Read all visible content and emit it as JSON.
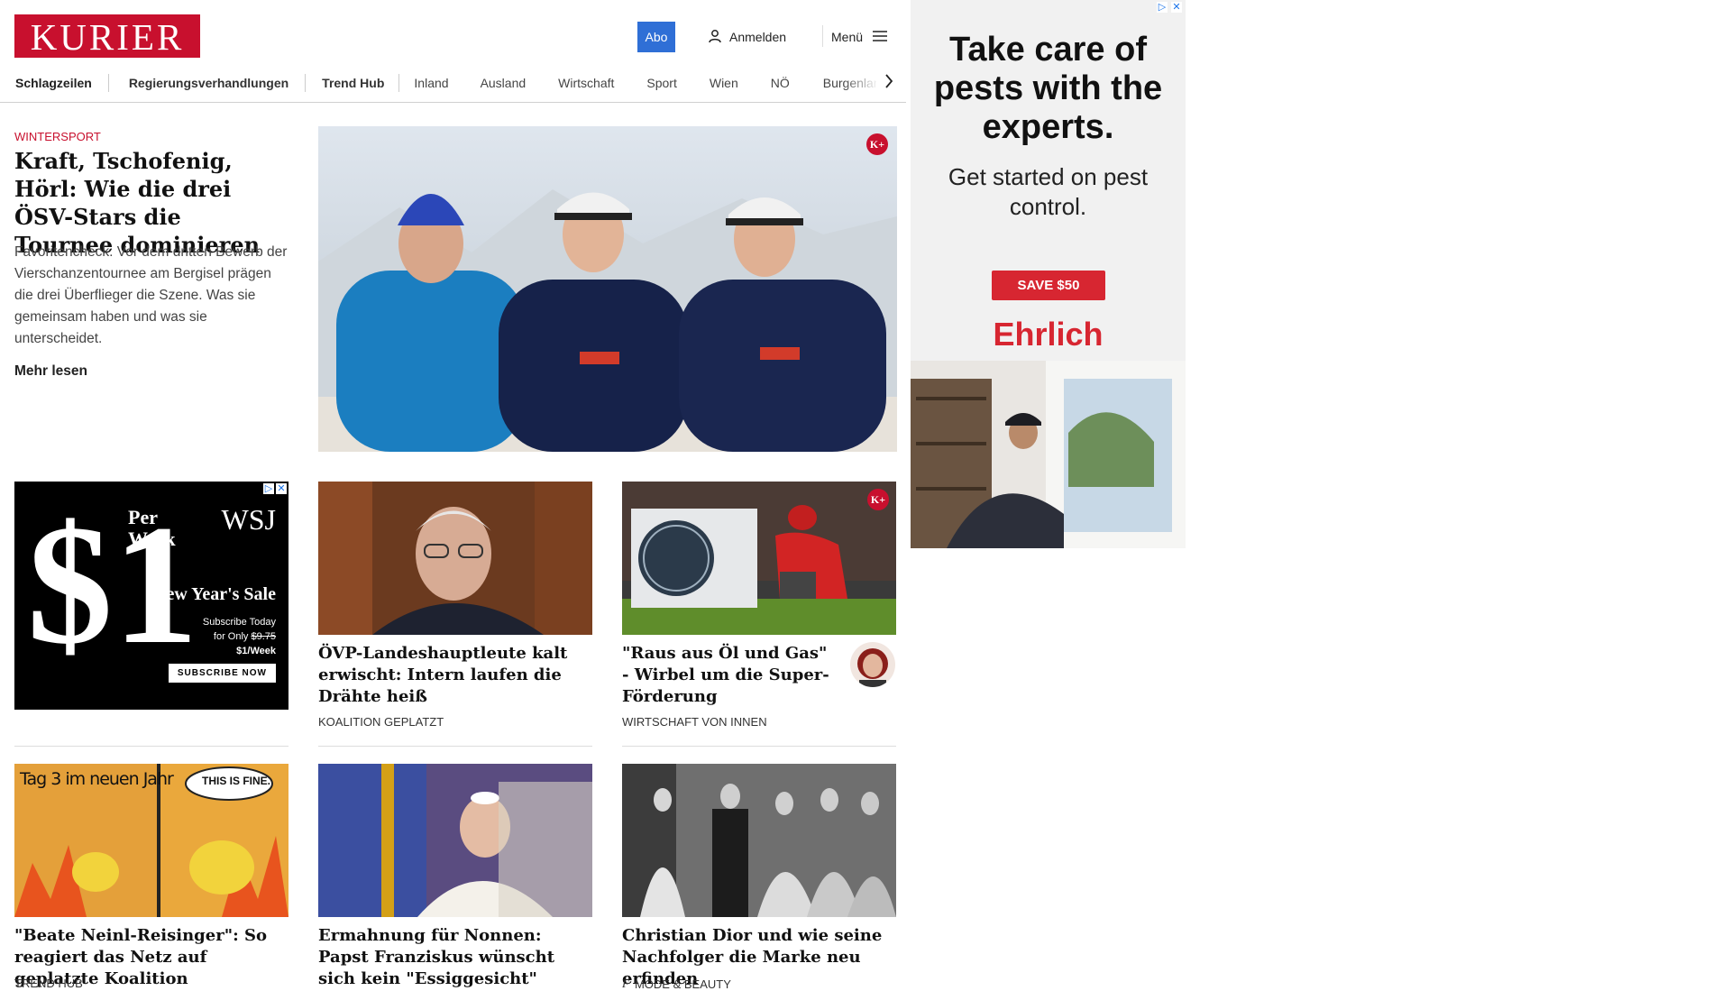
{
  "header": {
    "logo": "KURIER",
    "abo": "Abo",
    "login": "Anmelden",
    "menu": "Menü"
  },
  "nav": {
    "items": [
      "Schlagzeilen",
      "Regierungsverhandlungen",
      "Trend Hub",
      "Inland",
      "Ausland",
      "Wirtschaft",
      "Sport",
      "Wien",
      "NÖ",
      "Burgenland"
    ]
  },
  "lead": {
    "kicker": "WINTERSPORT",
    "title": "Kraft, Tschofenig, Hörl: Wie die drei ÖSV-Stars die Tournee dominieren",
    "teaser": "Favoritencheck: Vor dem dritten Bewerb der Vierschanzentournee am Bergisel prägen die drei Überflieger die Szene. Was sie gemeinsam haben und was sie unterscheidet.",
    "more": "Mehr lesen",
    "badge": "K+"
  },
  "cards": [
    {
      "title": "ÖVP-Landeshauptleute kalt erwischt: Intern laufen die Drähte heiß",
      "kicker": "KOALITION GEPLATZT"
    },
    {
      "title": "\"Raus aus Öl und Gas\" - Wirbel um die Super-Förderung",
      "kicker": "WIRTSCHAFT VON INNEN",
      "badge": "K+"
    },
    {
      "title": "\"Beate Neinl-Reisinger\": So reagiert das Netz auf geplatzte Koalition",
      "kicker": "TREND HUB",
      "meme_left": "Tag 3 im neuen Jahr",
      "meme_right": "THIS IS FINE."
    },
    {
      "title": "Ermahnung für Nonnen: Papst Franziskus wünscht sich kein \"Essiggesicht\"",
      "kicker": ""
    },
    {
      "title": "Christian Dior und wie seine Nachfolger die Marke neu erfinden",
      "kicker": "MODE & BEAUTY",
      "kicker_icon": "f"
    }
  ],
  "ad_wsj": {
    "dollar": "$1",
    "per": "Per",
    "week": "Week",
    "brand": "WSJ",
    "sale": "New Year's Sale",
    "line1": "Subscribe Today",
    "line2_prefix": "for Only",
    "old_price": "$9.75",
    "new_price": "$1/Week",
    "cta": "SUBSCRIBE NOW"
  },
  "ad_ehrlich": {
    "headline": "Take care of pests with the experts.",
    "sub": "Get started on pest control.",
    "cta": "SAVE $50",
    "brand": "Ehrlich"
  },
  "colors": {
    "brand_red": "#c8102e",
    "abo_blue": "#2f6fd6"
  }
}
